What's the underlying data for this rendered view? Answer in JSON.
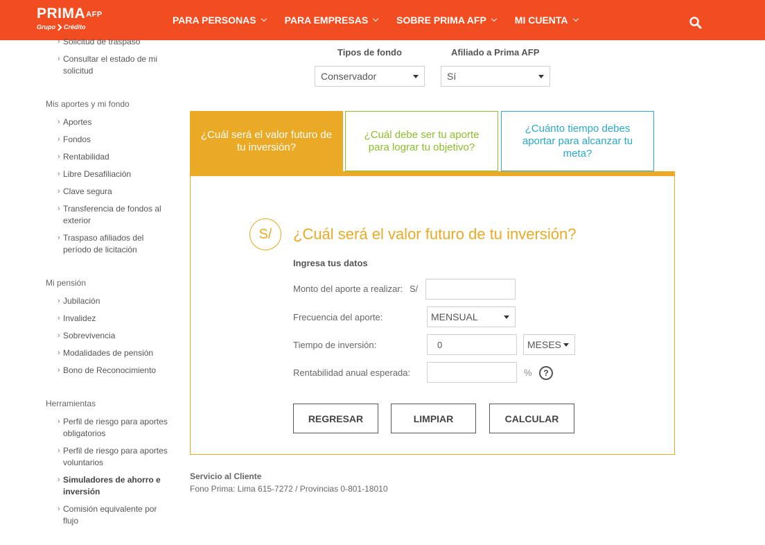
{
  "brand": {
    "name": "PRIMA",
    "sup": "AFP",
    "sub": "Grupo",
    "sub2": "Crédito"
  },
  "nav": [
    {
      "label": "PARA PERSONAS"
    },
    {
      "label": "PARA EMPRESAS"
    },
    {
      "label": "SOBRE PRIMA AFP"
    },
    {
      "label": "MI CUENTA"
    }
  ],
  "sidebar": {
    "top_items": [
      {
        "label": "Solicitud de traspaso"
      },
      {
        "label": "Consultar el estado de mi solicitud"
      }
    ],
    "groups": [
      {
        "title": "Mis aportes y mi fondo",
        "items": [
          {
            "label": "Aportes"
          },
          {
            "label": "Fondos"
          },
          {
            "label": "Rentabilidad"
          },
          {
            "label": "Libre Desafiliación"
          },
          {
            "label": "Clave segura"
          },
          {
            "label": "Transferencia de fondos al exterior"
          },
          {
            "label": "Traspaso afiliados del período de licitación"
          }
        ]
      },
      {
        "title": "Mi pensión",
        "items": [
          {
            "label": "Jubilación"
          },
          {
            "label": "Invalidez"
          },
          {
            "label": "Sobrevivencia"
          },
          {
            "label": "Modalidades de pensión"
          },
          {
            "label": "Bono de Reconocimiento"
          }
        ]
      },
      {
        "title": "Herramientas",
        "items": [
          {
            "label": "Perfil de riesgo para aportes obligatorios"
          },
          {
            "label": "Perfil de riesgo para aportes voluntarios"
          },
          {
            "label": "Simuladores de ahorro e inversión"
          },
          {
            "label": "Comisión equivalente por flujo"
          }
        ]
      }
    ]
  },
  "filters": {
    "fund_type": {
      "label": "Tipos de fondo",
      "value": "Conservador"
    },
    "affiliate": {
      "label": "Afiliado a Prima AFP",
      "value": "Sí"
    }
  },
  "tabs": [
    {
      "label": "¿Cuál será el valor futuro de tu inversión?"
    },
    {
      "label": "¿Cuál debe ser tu aporte para lograr tu objetivo?"
    },
    {
      "label": "¿Cuánto tiempo debes aportar para alcanzar tu meta?"
    }
  ],
  "calculator": {
    "currency_icon": "S/",
    "title": "¿Cuál será el valor futuro de tu inversión?",
    "subtitle": "Ingresa tus datos",
    "amount": {
      "label": "Monto del aporte a realizar:",
      "prefix": "S/",
      "value": ""
    },
    "frequency": {
      "label": "Frecuencia del aporte:",
      "value": "MENSUAL"
    },
    "time": {
      "label": "Tiempo de inversión:",
      "value": "0",
      "unit": "MESES"
    },
    "rate": {
      "label": "Rentabilidad anual esperada:",
      "value": "",
      "suffix": "%",
      "help": "?"
    },
    "buttons": {
      "back": "REGRESAR",
      "clear": "LIMPIAR",
      "calculate": "CALCULAR"
    }
  },
  "footer": {
    "title": "Servicio al Cliente",
    "phone": "Fono Prima: Lima 615-7272 / Provincias 0-801-18010"
  },
  "colors": {
    "header": "#f24d21",
    "tab_active": "#eaaa25",
    "tab_green": "#8bbf2a",
    "tab_blue": "#2aa9c8"
  }
}
